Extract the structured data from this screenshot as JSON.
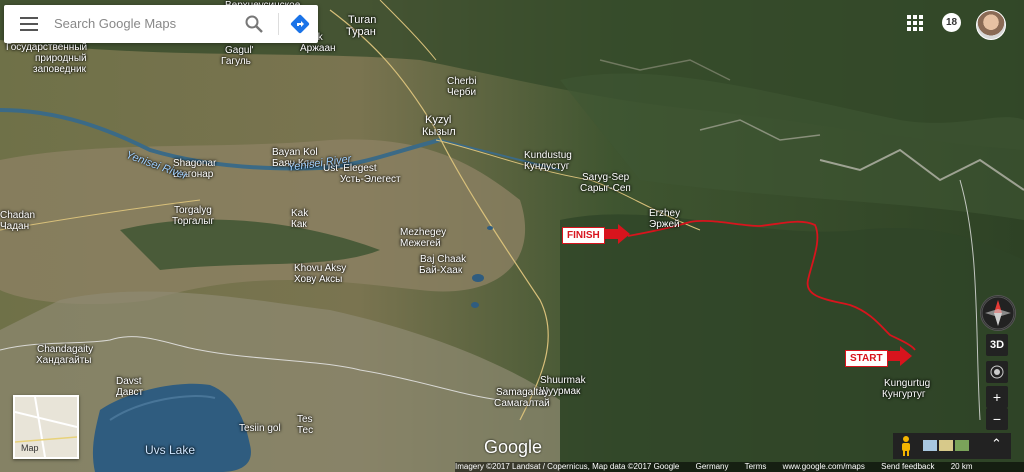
{
  "search": {
    "placeholder": "Search Google Maps"
  },
  "account": {
    "notification_count": "18"
  },
  "places": [
    {
      "name": "Верхнеусинское",
      "kind": "place"
    },
    {
      "name": "Turan",
      "kind": "city"
    },
    {
      "name": "Туран",
      "kind": "city"
    },
    {
      "name": "Uyuk",
      "kind": "place"
    },
    {
      "name": "Аржаан",
      "kind": "place"
    },
    {
      "name": "Gagul'",
      "kind": "place"
    },
    {
      "name": "Гагуль",
      "kind": "place"
    },
    {
      "name": "Государственный",
      "kind": "place"
    },
    {
      "name": "природный",
      "kind": "place"
    },
    {
      "name": "заповедник",
      "kind": "place"
    },
    {
      "name": "Cherbi",
      "kind": "place"
    },
    {
      "name": "Черби",
      "kind": "place"
    },
    {
      "name": "Kyzyl",
      "kind": "city"
    },
    {
      "name": "Кызыл",
      "kind": "city"
    },
    {
      "name": "Bayan Kol",
      "kind": "place"
    },
    {
      "name": "Баян Кол",
      "kind": "place"
    },
    {
      "name": "Ust'-Elegest",
      "kind": "place"
    },
    {
      "name": "Усть-Элегест",
      "kind": "place"
    },
    {
      "name": "Shagonar",
      "kind": "place"
    },
    {
      "name": "Шагонар",
      "kind": "place"
    },
    {
      "name": "Kundustug",
      "kind": "place"
    },
    {
      "name": "Кундустуг",
      "kind": "place"
    },
    {
      "name": "Saryg-Sep",
      "kind": "place"
    },
    {
      "name": "Сарыг-Сеп",
      "kind": "place"
    },
    {
      "name": "Chadan",
      "kind": "place"
    },
    {
      "name": "Чадан",
      "kind": "place"
    },
    {
      "name": "Torgalyg",
      "kind": "place"
    },
    {
      "name": "Торгалыг",
      "kind": "place"
    },
    {
      "name": "Kak",
      "kind": "place"
    },
    {
      "name": "Как",
      "kind": "place"
    },
    {
      "name": "Mezhegey",
      "kind": "place"
    },
    {
      "name": "Межегей",
      "kind": "place"
    },
    {
      "name": "Erzhey",
      "kind": "place"
    },
    {
      "name": "Эржей",
      "kind": "place"
    },
    {
      "name": "Baj Chaak",
      "kind": "place"
    },
    {
      "name": "Бай-Хаак",
      "kind": "place"
    },
    {
      "name": "Khovu Aksy",
      "kind": "place"
    },
    {
      "name": "Хову Аксы",
      "kind": "place"
    },
    {
      "name": "Chandagaity",
      "kind": "place"
    },
    {
      "name": "Хандагайты",
      "kind": "place"
    },
    {
      "name": "Davst",
      "kind": "place"
    },
    {
      "name": "Давст",
      "kind": "place"
    },
    {
      "name": "Shuurmak",
      "kind": "place"
    },
    {
      "name": "Шуурмак",
      "kind": "place"
    },
    {
      "name": "Samagaltay",
      "kind": "place"
    },
    {
      "name": "Самагалтай",
      "kind": "place"
    },
    {
      "name": "Kungurtug",
      "kind": "place"
    },
    {
      "name": "Кунгуртуг",
      "kind": "place"
    },
    {
      "name": "Tes",
      "kind": "place"
    },
    {
      "name": "Тес",
      "kind": "place"
    },
    {
      "name": "Tesiin gol",
      "kind": "water"
    },
    {
      "name": "Uvs Lake",
      "kind": "lake"
    },
    {
      "name": "Yenisei River",
      "kind": "water"
    },
    {
      "name": "Yenisei River",
      "kind": "water"
    }
  ],
  "annotations": {
    "finish": "FINISH",
    "start": "START",
    "color": "#d8141d"
  },
  "controls": {
    "three_d": "3D",
    "zoom_in": "+",
    "zoom_out": "−",
    "expand": "⌃"
  },
  "minimap": {
    "label": "Map"
  },
  "brand": "Google",
  "footer": {
    "imagery": "Imagery ©2017 Landsat / Copernicus, Map data ©2017 Google",
    "germany": "Germany",
    "terms": "Terms",
    "url": "www.google.com/maps",
    "feedback": "Send feedback",
    "scale": "20 km"
  }
}
